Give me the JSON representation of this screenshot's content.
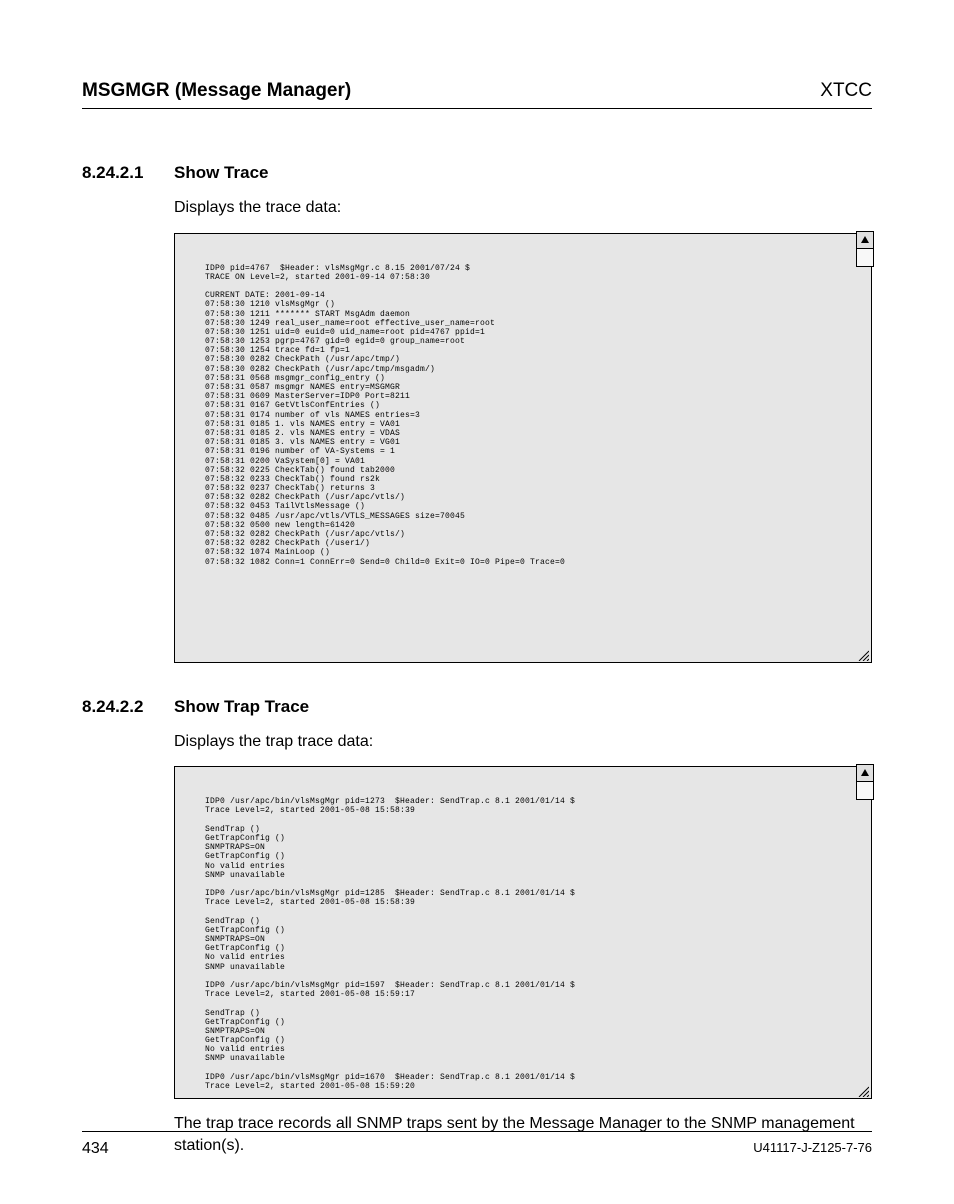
{
  "header": {
    "left": "MSGMGR (Message Manager)",
    "right": "XTCC"
  },
  "section1": {
    "number": "8.24.2.1",
    "title": "Show Trace",
    "intro": "Displays the trace data:",
    "trace": "IDP0 pid=4767  $Header: vlsMsgMgr.c 8.15 2001/07/24 $\nTRACE ON Level=2, started 2001-09-14 07:58:30\n\nCURRENT DATE: 2001-09-14\n07:58:30 1210 vlsMsgMgr ()\n07:58:30 1211 ******* START MsgAdm daemon\n07:58:30 1249 real_user_name=root effective_user_name=root\n07:58:30 1251 uid=0 euid=0 uid_name=root pid=4767 ppid=1\n07:58:30 1253 pgrp=4767 gid=0 egid=0 group_name=root\n07:58:30 1254 trace fd=1 fp=1\n07:58:30 0282 CheckPath (/usr/apc/tmp/)\n07:58:30 0282 CheckPath (/usr/apc/tmp/msgadm/)\n07:58:31 0568 msgmgr_config_entry ()\n07:58:31 0587 msgmgr NAMES entry=MSGMGR\n07:58:31 0609 MasterServer=IDP0 Port=8211\n07:58:31 0167 GetVtlsConfEntries ()\n07:58:31 0174 number of vls NAMES entries=3\n07:58:31 0185 1. vls NAMES entry = VA01\n07:58:31 0185 2. vls NAMES entry = VDAS\n07:58:31 0185 3. vls NAMES entry = VG01\n07:58:31 0196 number of VA-Systems = 1\n07:58:31 0200 VaSystem[0] = VA01\n07:58:32 0225 CheckTab() found tab2000\n07:58:32 0233 CheckTab() found rs2k\n07:58:32 0237 CheckTab() returns 3\n07:58:32 0282 CheckPath (/usr/apc/vtls/)\n07:58:32 0453 TailVtlsMessage ()\n07:58:32 0485 /usr/apc/vtls/VTLS_MESSAGES size=70045\n07:58:32 0500 new length=61420\n07:58:32 0282 CheckPath (/usr/apc/vtls/)\n07:58:32 0282 CheckPath (/user1/)\n07:58:32 1074 MainLoop ()\n07:58:32 1082 Conn=1 ConnErr=0 Send=0 Child=0 Exit=0 IO=0 Pipe=0 Trace=0"
  },
  "section2": {
    "number": "8.24.2.2",
    "title": "Show Trap Trace",
    "intro": "Displays the trap trace data:",
    "trace": "IDP0 /usr/apc/bin/vlsMsgMgr pid=1273  $Header: SendTrap.c 8.1 2001/01/14 $\nTrace Level=2, started 2001-05-08 15:58:39\n\nSendTrap ()\nGetTrapConfig ()\nSNMPTRAPS=ON\nGetTrapConfig ()\nNo valid entries\nSNMP unavailable\n\nIDP0 /usr/apc/bin/vlsMsgMgr pid=1285  $Header: SendTrap.c 8.1 2001/01/14 $\nTrace Level=2, started 2001-05-08 15:58:39\n\nSendTrap ()\nGetTrapConfig ()\nSNMPTRAPS=ON\nGetTrapConfig ()\nNo valid entries\nSNMP unavailable\n\nIDP0 /usr/apc/bin/vlsMsgMgr pid=1597  $Header: SendTrap.c 8.1 2001/01/14 $\nTrace Level=2, started 2001-05-08 15:59:17\n\nSendTrap ()\nGetTrapConfig ()\nSNMPTRAPS=ON\nGetTrapConfig ()\nNo valid entries\nSNMP unavailable\n\nIDP0 /usr/apc/bin/vlsMsgMgr pid=1670  $Header: SendTrap.c 8.1 2001/01/14 $\nTrace Level=2, started 2001-05-08 15:59:20",
    "outro": "The trap trace records all SNMP traps sent by the Message Manager to the SNMP management station(s)."
  },
  "footer": {
    "page": "434",
    "docid": "U41117-J-Z125-7-76"
  }
}
